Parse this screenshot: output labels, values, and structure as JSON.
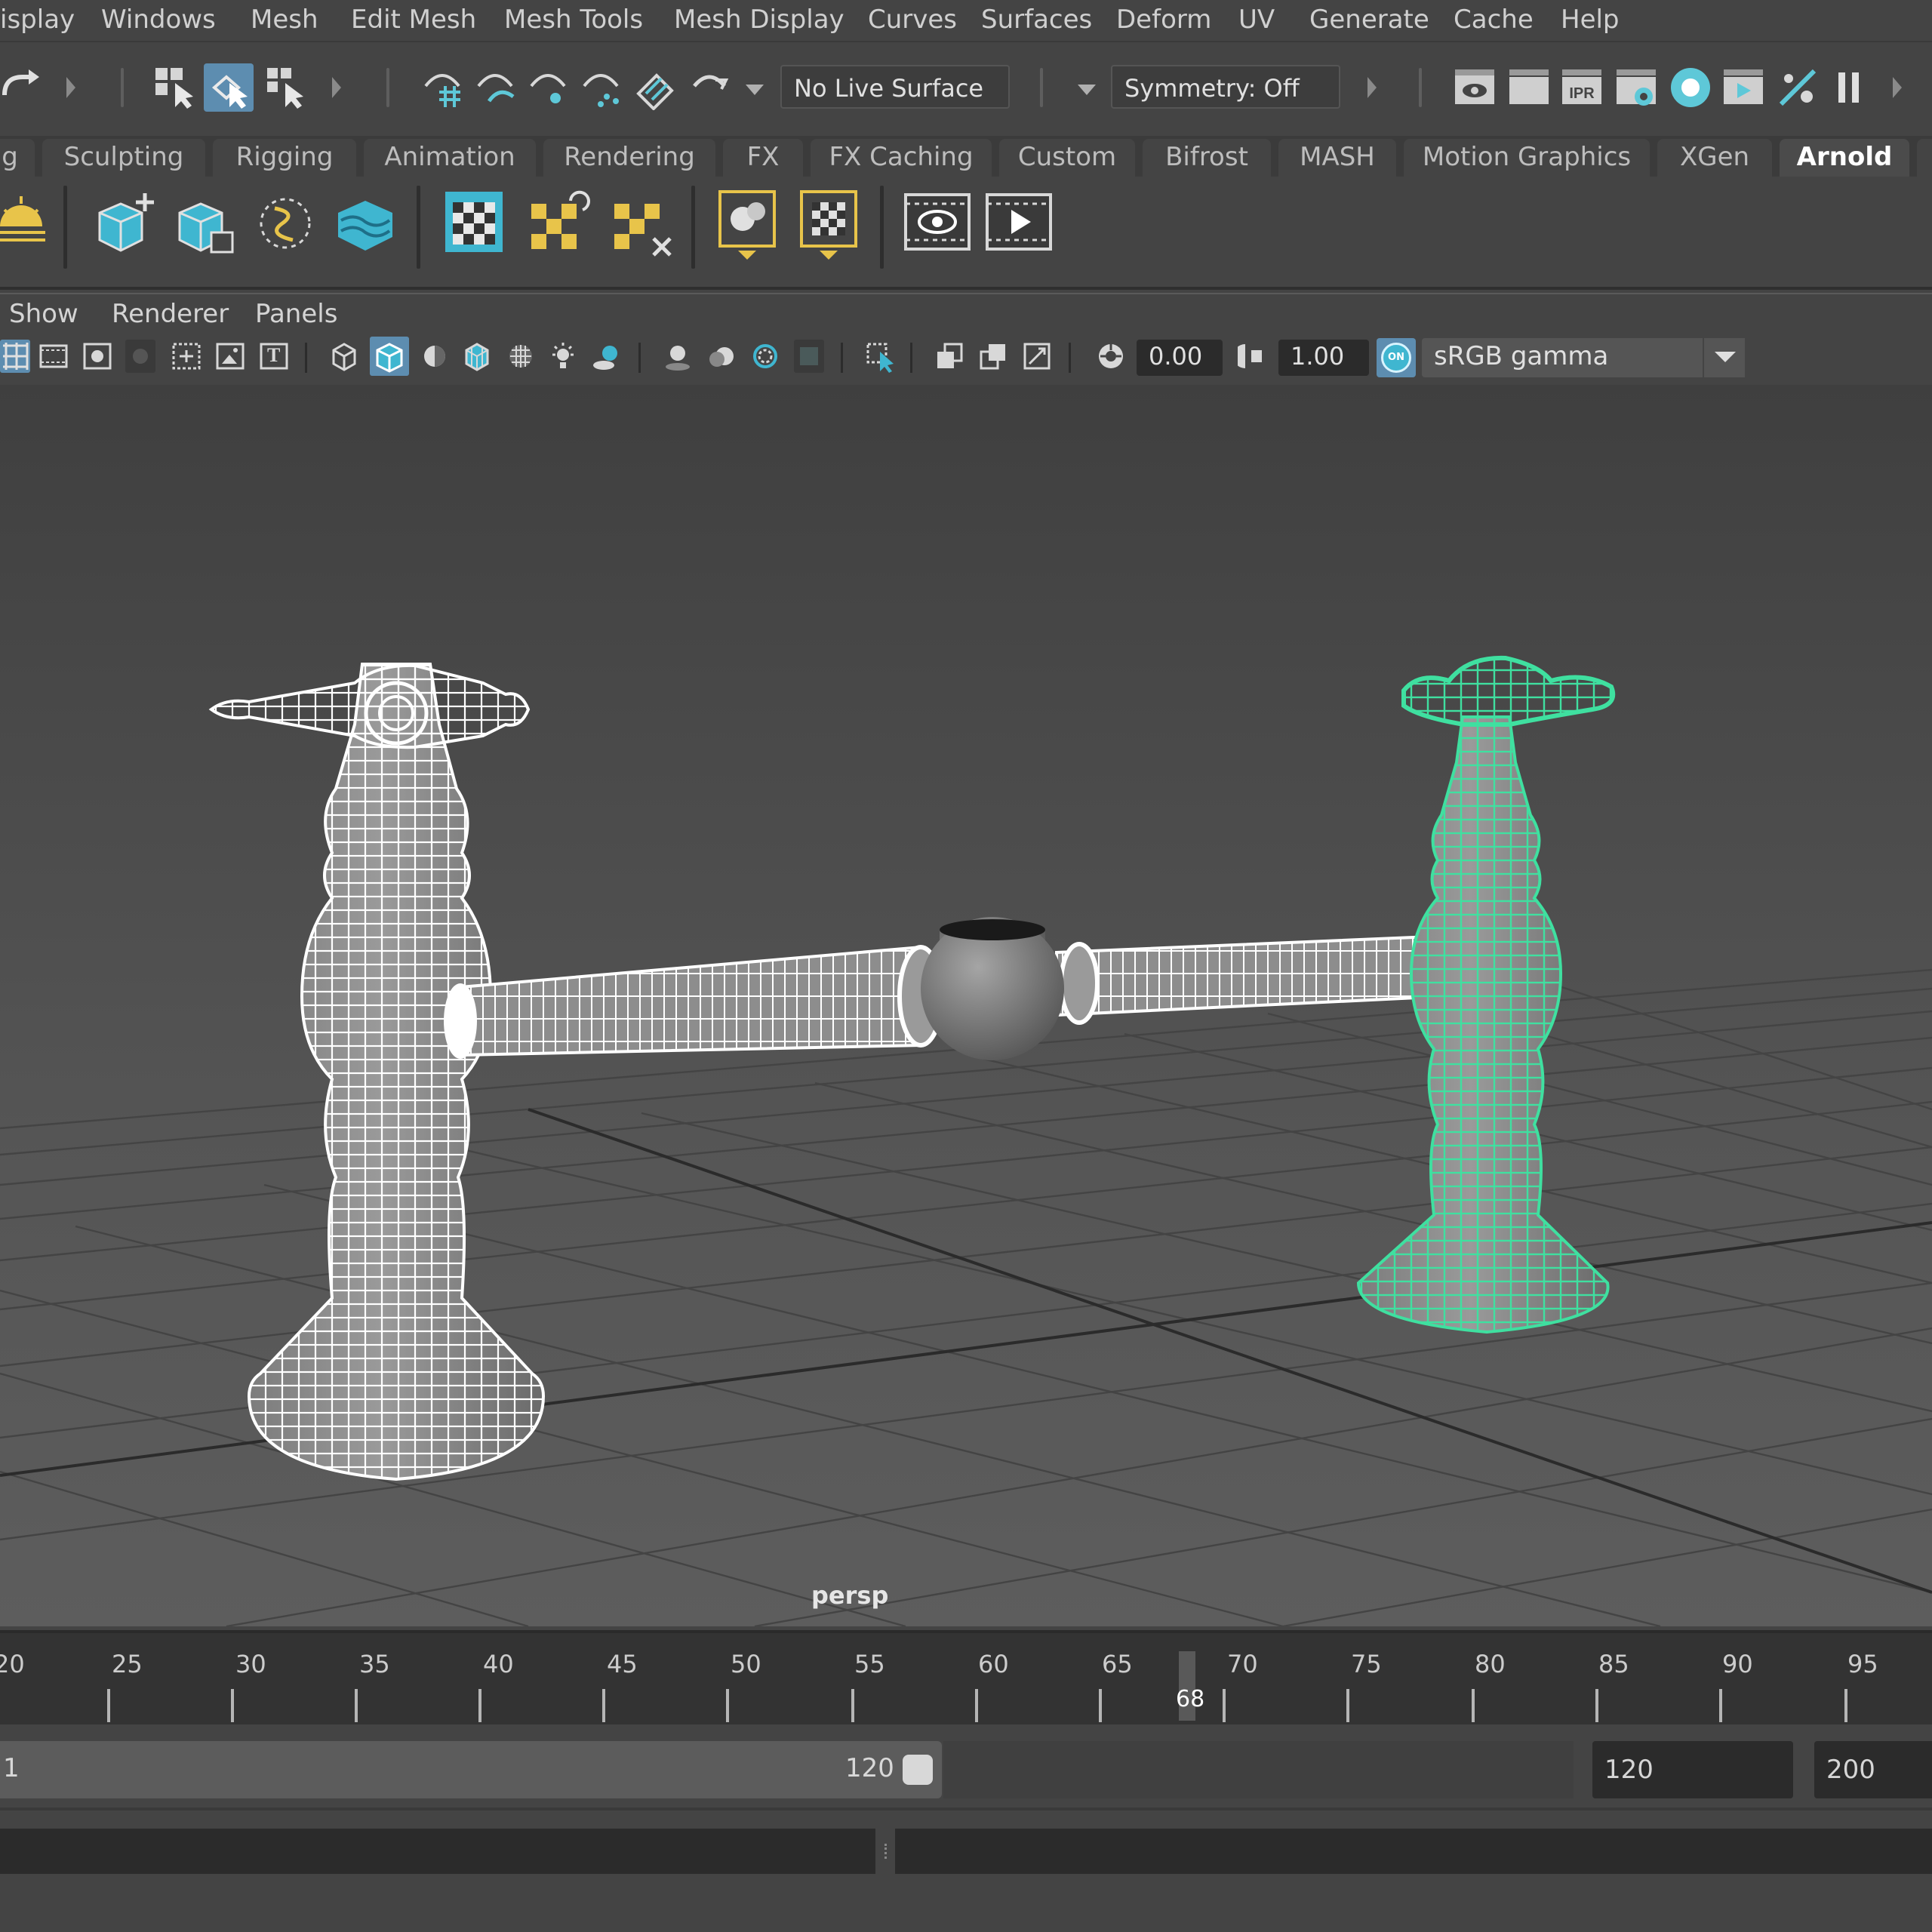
{
  "menubar": {
    "items": [
      "isplay",
      "Windows",
      "Mesh",
      "Edit Mesh",
      "Mesh Tools",
      "Mesh Display",
      "Curves",
      "Surfaces",
      "Deform",
      "UV",
      "Generate",
      "Cache",
      "Help"
    ]
  },
  "statusline": {
    "live_surface": "No Live Surface",
    "symmetry": "Symmetry: Off",
    "ipr_label": "IPR"
  },
  "shelf_tabs": {
    "items": [
      "g",
      "Sculpting",
      "Rigging",
      "Animation",
      "Rendering",
      "FX",
      "FX Caching",
      "Custom",
      "Bifrost",
      "MASH",
      "Motion Graphics",
      "XGen",
      "Arnold"
    ],
    "active": "Arnold"
  },
  "panel_menu": {
    "items": [
      "Show",
      "Renderer",
      "Panels"
    ]
  },
  "panel_toolbar": {
    "exposure": "0.00",
    "gamma": "1.00",
    "colorspace": "sRGB gamma",
    "on_badge": "ON",
    "text_icon": "T"
  },
  "viewport": {
    "camera": "persp",
    "selection_color": "#3fe0a0",
    "wire_color": "#ffffff"
  },
  "timeline": {
    "tick_labels": [
      "20",
      "25",
      "30",
      "35",
      "40",
      "45",
      "50",
      "55",
      "60",
      "65",
      "70",
      "75",
      "80",
      "85",
      "90",
      "95"
    ],
    "current_frame": "68"
  },
  "range": {
    "start": "1",
    "range_end": "120",
    "anim_end": "120",
    "max": "200"
  },
  "icons": [
    "undo-icon",
    "redo-icon",
    "select-by-hierarchy-icon",
    "select-by-object-icon",
    "select-by-component-icon",
    "snap-grid-icon",
    "snap-curve-icon",
    "snap-point-icon",
    "snap-view-plane-icon",
    "snap-live-icon",
    "magnet-icon",
    "render-view-icon",
    "render-icon",
    "ipr-render-icon",
    "render-settings-icon",
    "hypershade-icon",
    "playblast-icon",
    "arnold-render-icon",
    "pause-icon",
    "skydome-light-icon",
    "create-mesh-icon",
    "standin-icon",
    "curve-collector-icon",
    "volume-icon",
    "texture-manager-icon",
    "flush-cache-icon",
    "delete-cache-icon",
    "material-assign-icon",
    "shader-checker-icon",
    "view-render-icon",
    "render-play-icon"
  ]
}
